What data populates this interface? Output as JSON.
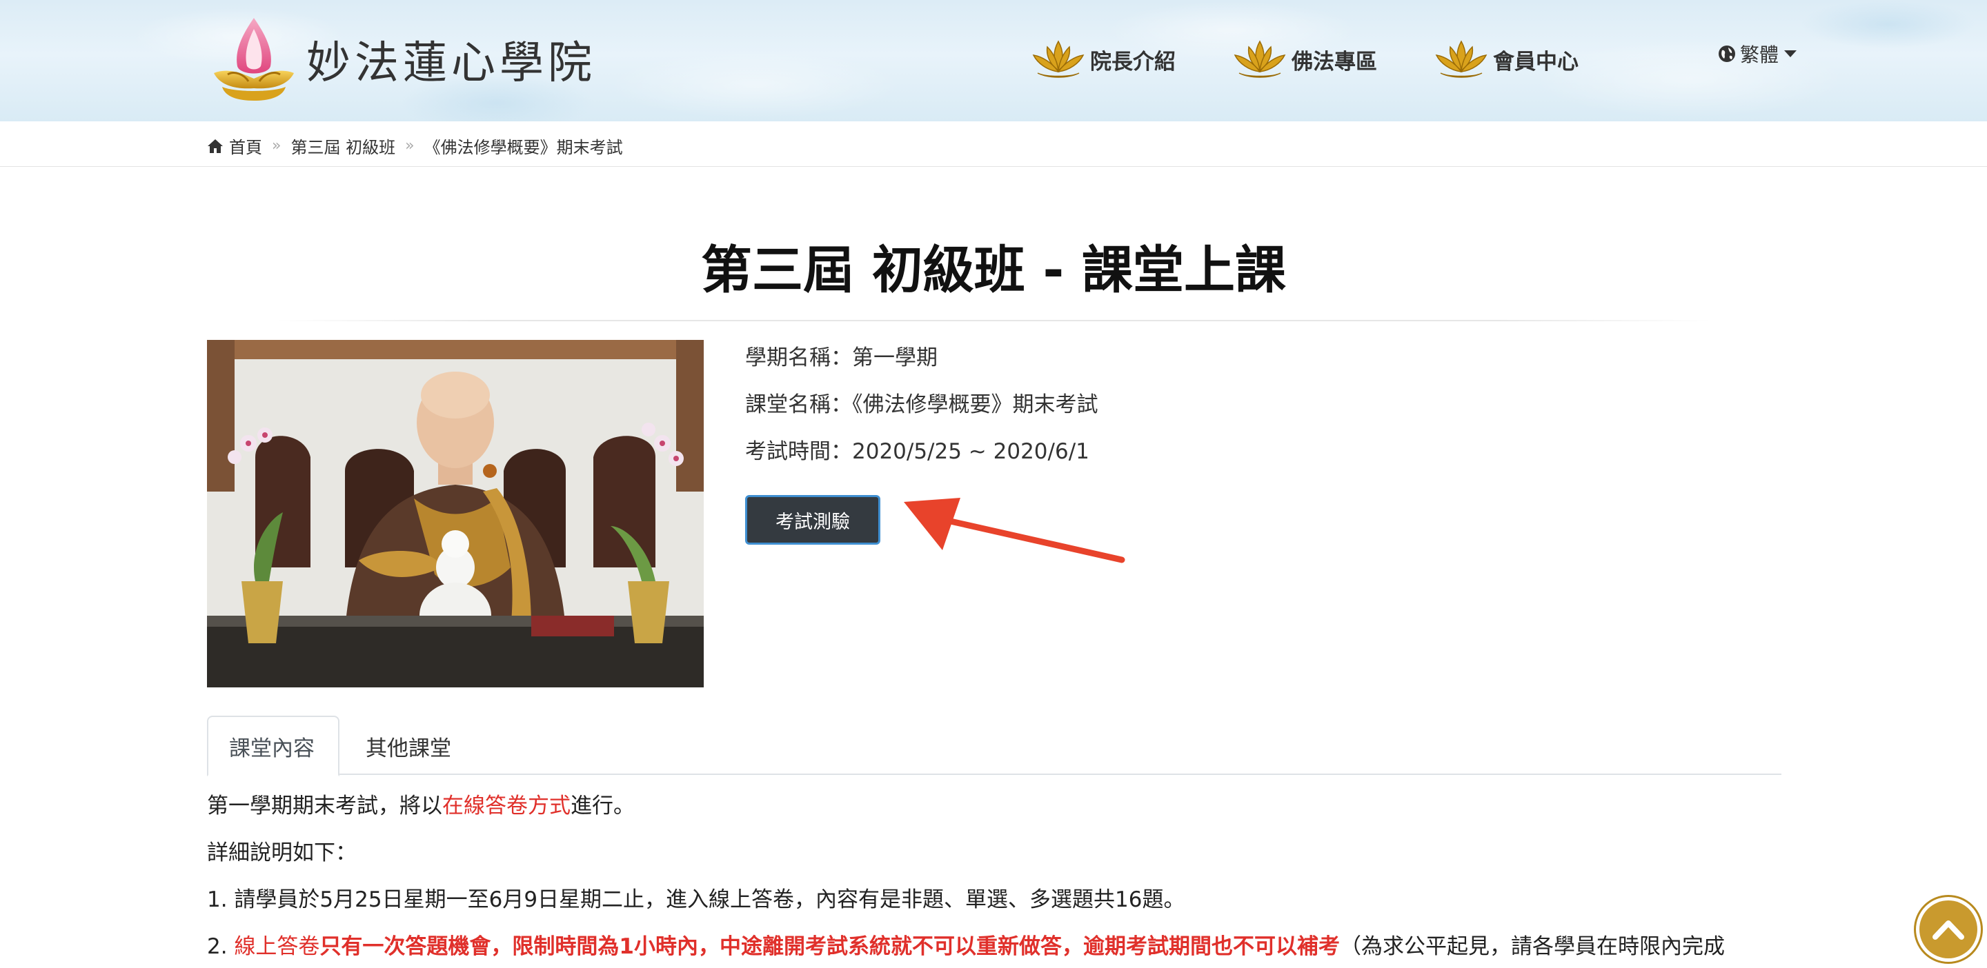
{
  "header": {
    "site_title": "妙法蓮心學院",
    "nav": [
      {
        "label": "院長介紹",
        "icon": "lotus-icon"
      },
      {
        "label": "佛法專區",
        "icon": "lotus-icon"
      },
      {
        "label": "會員中心",
        "icon": "lotus-icon"
      }
    ],
    "language": {
      "label": "繁體",
      "icon": "globe-icon"
    },
    "colors": {
      "background": "#dcecf6",
      "lotus": "#d9a21c"
    }
  },
  "breadcrumb": {
    "items": [
      "首頁",
      "第三屆 初級班",
      "《佛法修學概要》期末考試"
    ]
  },
  "page_title": "第三屆 初級班 - 課堂上課",
  "course_info": {
    "term": "學期名稱：第一學期",
    "class_name": "課堂名稱：《佛法修學概要》期末考試",
    "exam_time": "考試時間：2020/5/25 ~ 2020/6/1",
    "exam_button": "考試測驗"
  },
  "tabs": [
    {
      "label": "課堂內容",
      "active": true
    },
    {
      "label": "其他課堂",
      "active": false
    }
  ],
  "content": {
    "line1": {
      "before": "第一學期期末考試，將以",
      "highlight": "在線答卷方式",
      "after": "進行。"
    },
    "line2": "詳細說明如下：",
    "line3": "1. 請學員於5月25日星期一至6月9日星期二止，進入線上答卷，內容有是非題、單選、多選題共16題。",
    "line4": {
      "prefix": "2. ",
      "red1": "線上答卷",
      "red_bold": "只有一次答題機會，限制時間為1小時內，中途離開考試系統就不可以重新做答，逾期考試期間也不可以補考",
      "after": "（為求公平起見，請各學員在時限內完成"
    }
  },
  "accent_colors": {
    "highlight_red": "#e0302b",
    "button_dark": "#343a40",
    "button_border": "#3f8fd1",
    "arrow": "#e8432b"
  }
}
